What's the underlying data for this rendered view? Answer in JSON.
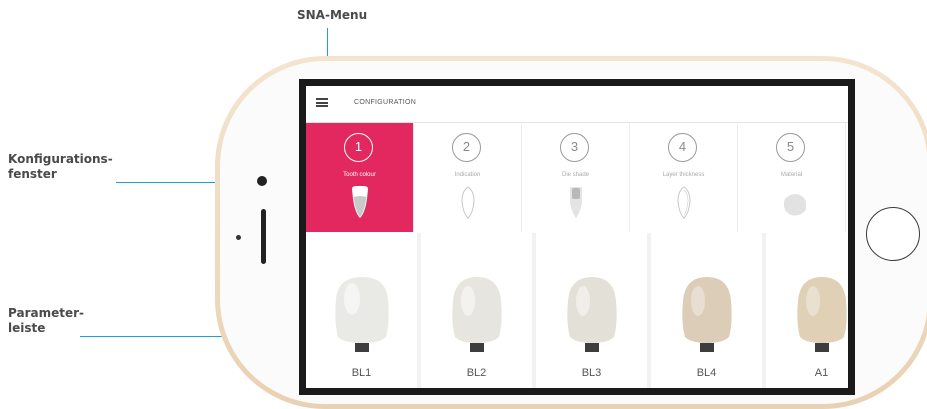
{
  "callouts": {
    "sna_menu": "SNA-Menu",
    "config_window_line1": "Konfigurations-",
    "config_window_line2": "fenster",
    "param_bar_line1": "Parameter-",
    "param_bar_line2": "leiste"
  },
  "colors": {
    "accent": "#e2285e",
    "callout_line": "#1e9fd8",
    "phone_frame": "#efdcc2"
  },
  "app": {
    "header": {
      "menu_icon": "hamburger-menu-icon",
      "title": "CONFIGURATION"
    },
    "steps": [
      {
        "number": "1",
        "label": "Tooth colour",
        "active": true,
        "icon": "tooth-icon"
      },
      {
        "number": "2",
        "label": "Indication",
        "active": false,
        "icon": "crown-outline-icon"
      },
      {
        "number": "3",
        "label": "Die shade",
        "active": false,
        "icon": "die-icon"
      },
      {
        "number": "4",
        "label": "Layer thickness",
        "active": false,
        "icon": "layer-outline-icon"
      },
      {
        "number": "5",
        "label": "Material",
        "active": false,
        "icon": "material-blob-icon"
      }
    ],
    "shades": [
      {
        "label": "BL1",
        "color": "#e9e9e6"
      },
      {
        "label": "BL2",
        "color": "#e6e5df"
      },
      {
        "label": "BL3",
        "color": "#e3e0d8"
      },
      {
        "label": "BL4",
        "color": "#dccdb9"
      },
      {
        "label": "A1",
        "color": "#dfd0b6"
      }
    ]
  }
}
